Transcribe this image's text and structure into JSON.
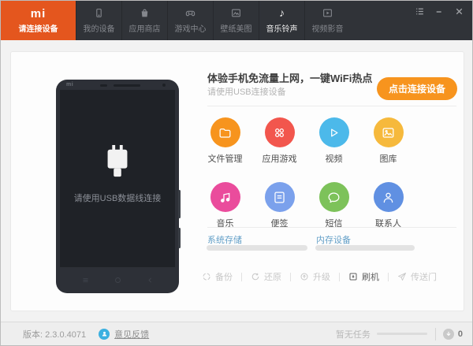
{
  "colors": {
    "topbar_bg": "#303338",
    "active_tab_orange": "#e4561e",
    "connect_button_orange": "#f7941e",
    "storage_label_blue": "#64a0c8",
    "feedback_icon_blue": "#3cb0e0",
    "feature_colors": {
      "file_manager": "#f7941e",
      "apps_games": "#f2564d",
      "video": "#4cb9ea",
      "gallery": "#f6b93c",
      "music": "#ea4c9c",
      "notes": "#7ba1ec",
      "sms": "#7dc25a",
      "contacts": "#6090e2"
    }
  },
  "titlebar": {
    "logo_text": "mi",
    "active_tab_label": "请连接设备",
    "tabs": [
      {
        "label": "我的设备",
        "icon": "phone-icon"
      },
      {
        "label": "应用商店",
        "icon": "bag-icon"
      },
      {
        "label": "游戏中心",
        "icon": "gamepad-icon"
      },
      {
        "label": "壁纸美图",
        "icon": "wallpaper-icon"
      },
      {
        "label": "音乐铃声",
        "icon": "music-note-icon",
        "highlighted": true
      },
      {
        "label": "视频影音",
        "icon": "video-icon"
      }
    ],
    "window_controls": [
      "menu-icon",
      "minimize-icon",
      "close-icon"
    ]
  },
  "phone": {
    "logo_text": "mi",
    "screen_message": "请使用USB数据线连接"
  },
  "main": {
    "headline": "体验手机免流量上网，一键WiFi热点",
    "subtext": "请使用USB连接设备",
    "connect_button_label": "点击连接设备",
    "features": [
      {
        "label": "文件管理",
        "icon": "folder-icon",
        "color": "#f7941e"
      },
      {
        "label": "应用游戏",
        "icon": "apps-icon",
        "color": "#f2564d"
      },
      {
        "label": "视频",
        "icon": "play-icon",
        "color": "#4cb9ea"
      },
      {
        "label": "图库",
        "icon": "gallery-icon",
        "color": "#f6b93c"
      },
      {
        "label": "音乐",
        "icon": "music-icon",
        "color": "#ea4c9c"
      },
      {
        "label": "便签",
        "icon": "note-icon",
        "color": "#7ba1ec"
      },
      {
        "label": "短信",
        "icon": "sms-icon",
        "color": "#7dc25a"
      },
      {
        "label": "联系人",
        "icon": "contact-icon",
        "color": "#6090e2"
      }
    ],
    "storage": [
      {
        "label": "系统存储",
        "percent": 0
      },
      {
        "label": "内存设备",
        "percent": 0
      }
    ],
    "actions": [
      {
        "label": "备份",
        "icon": "backup-icon",
        "enabled": false
      },
      {
        "label": "还原",
        "icon": "restore-icon",
        "enabled": false
      },
      {
        "label": "升级",
        "icon": "upgrade-icon",
        "enabled": false
      },
      {
        "label": "刷机",
        "icon": "flash-icon",
        "enabled": true
      },
      {
        "label": "传送门",
        "icon": "portal-icon",
        "enabled": false
      }
    ]
  },
  "statusbar": {
    "version": "版本: 2.3.0.4071",
    "feedback_link": "意见反馈",
    "task_status": "暂无任务",
    "download_count": "0"
  }
}
